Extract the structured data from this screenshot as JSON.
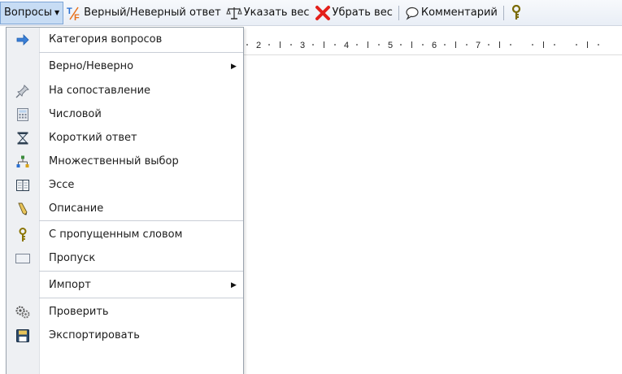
{
  "toolbar": {
    "questions_menu": "Вопросы",
    "true_false": "Верный/Неверный ответ",
    "set_weight": "Указать вес",
    "remove_weight": "Убрать вес",
    "comment": "Комментарий"
  },
  "ruler": {
    "numbers": [
      "2",
      "3",
      "4",
      "5",
      "6",
      "7"
    ]
  },
  "menu": {
    "items": [
      {
        "label": "Категория вопросов"
      },
      {
        "label": "Верно/Неверно"
      },
      {
        "label": "На сопоставление"
      },
      {
        "label": "Числовой"
      },
      {
        "label": "Короткий ответ"
      },
      {
        "label": "Множественный выбор"
      },
      {
        "label": "Эссе"
      },
      {
        "label": "Описание"
      },
      {
        "label": "С пропущенным словом"
      },
      {
        "label": "Пропуск"
      },
      {
        "label": "Импорт"
      },
      {
        "label": "Проверить"
      },
      {
        "label": "Экспортировать"
      }
    ]
  },
  "colors": {
    "menu_highlight": "#c7dcf4",
    "remove_red": "#e3201b",
    "tf_orange": "#e8701a"
  }
}
